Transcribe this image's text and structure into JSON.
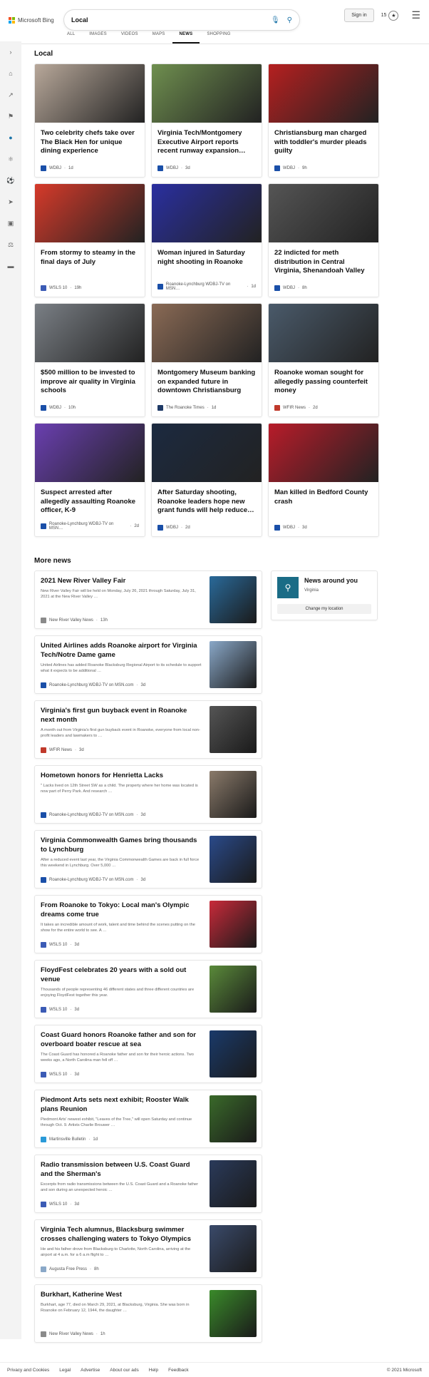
{
  "header": {
    "brand": "Microsoft Bing",
    "query": "Local",
    "signin": "Sign in",
    "points": "15"
  },
  "tabs": [
    "ALL",
    "IMAGES",
    "VIDEOS",
    "MAPS",
    "NEWS",
    "SHOPPING"
  ],
  "active_tab": "NEWS",
  "local": {
    "title": "Local",
    "cards": [
      {
        "title": "Two celebrity chefs take over The Black Hen for unique dining experience",
        "source": "WDBJ",
        "age": "1d",
        "img": "#b8a89a",
        "ic": "#1a4fa8"
      },
      {
        "title": "Virginia Tech/Montgomery Executive Airport reports recent runway expansion…",
        "source": "WDBJ",
        "age": "3d",
        "img": "#6f8f4f",
        "ic": "#1a4fa8"
      },
      {
        "title": "Christiansburg man charged with toddler's murder pleads guilty",
        "source": "WDBJ",
        "age": "9h",
        "img": "#b52020",
        "ic": "#1a4fa8"
      },
      {
        "title": "From stormy to steamy in the final days of July",
        "source": "WSLS 10",
        "age": "19h",
        "img": "#d63a2a",
        "ic": "#3b5bb5"
      },
      {
        "title": "Woman injured in Saturday night shooting in Roanoke",
        "source": "Roanoke-Lynchburg WDBJ-TV on MSN…",
        "age": "1d",
        "img": "#2a2fa0",
        "ic": "#1a4fa8"
      },
      {
        "title": "22 indicted for meth distribution in Central Virginia, Shenandoah Valley",
        "source": "WDBJ",
        "age": "8h",
        "img": "#555555",
        "ic": "#1a4fa8"
      },
      {
        "title": "$500 million to be invested to improve air quality in Virginia schools",
        "source": "WDBJ",
        "age": "10h",
        "img": "#7a7f85",
        "ic": "#1a4fa8"
      },
      {
        "title": "Montgomery Museum banking on expanded future in downtown Christiansburg",
        "source": "The Roanoke Times",
        "age": "1d",
        "img": "#8a6a55",
        "ic": "#1f3a66"
      },
      {
        "title": "Roanoke woman sought for allegedly passing counterfeit money",
        "source": "WFIR News",
        "age": "2d",
        "img": "#4a5a6a",
        "ic": "#c0392b"
      },
      {
        "title": "Suspect arrested after allegedly assaulting Roanoke officer, K-9",
        "source": "Roanoke-Lynchburg WDBJ-TV on MSN…",
        "age": "2d",
        "img": "#6a3fb0",
        "ic": "#1a4fa8"
      },
      {
        "title": "After Saturday shooting, Roanoke leaders hope new grant funds will help reduce…",
        "source": "WDBJ",
        "age": "2d",
        "img": "#1c2a40",
        "ic": "#1a4fa8"
      },
      {
        "title": "Man killed in Bedford County crash",
        "source": "WDBJ",
        "age": "3d",
        "img": "#b81c2a",
        "ic": "#1a4fa8"
      }
    ]
  },
  "more": {
    "title": "More news",
    "items": [
      {
        "title": "2021 New River Valley Fair",
        "snippet": "New River Valley Fair will be held on Monday, July 26, 2021 through Saturday, July 31, 2021 at the New River Valley …",
        "source": "New River Valley News",
        "age": "13h",
        "img": "#2a6a9a",
        "ic": "#8a8a8a"
      },
      {
        "title": "United Airlines adds Roanoke airport for Virginia Tech/Notre Dame game",
        "snippet": "United Airlines has added Roanoke Blacksburg Regional Airport to its schedule to support what it expects to be additional …",
        "source": "Roanoke-Lynchburg WDBJ-TV on MSN.com",
        "age": "3d",
        "img": "#8aa8c8",
        "ic": "#1a4fa8"
      },
      {
        "title": "Virginia's first gun buyback event in Roanoke next month",
        "snippet": "A month out from Virginia's first gun buyback event in Roanoke, everyone from local non-profit leaders and lawmakers to …",
        "source": "WFIR News",
        "age": "3d",
        "img": "#555555",
        "ic": "#c0392b"
      },
      {
        "title": "Hometown honors for Henrietta Lacks",
        "snippet": "\" Lacks lived on 12th Street SW as a child. The property where her home was located is now part of Perry Park. And research …",
        "source": "Roanoke-Lynchburg WDBJ-TV on MSN.com",
        "age": "3d",
        "img": "#8a7a6a",
        "ic": "#1a4fa8"
      },
      {
        "title": "Virginia Commonwealth Games bring thousands to Lynchburg",
        "snippet": "After a reduced event last year, the Virginia Commonwealth Games are back in full force this weekend in Lynchburg. Over 5,000 …",
        "source": "Roanoke-Lynchburg WDBJ-TV on MSN.com",
        "age": "3d",
        "img": "#2a4a8a",
        "ic": "#1a4fa8"
      },
      {
        "title": "From Roanoke to Tokyo: Local man's Olympic dreams come true",
        "snippet": "It takes an incredible amount of work, talent and time behind the scenes putting on the show for the entire world to see. A …",
        "source": "WSLS 10",
        "age": "3d",
        "img": "#c82a3a",
        "ic": "#3b5bb5"
      },
      {
        "title": "FloydFest celebrates 20 years with a sold out venue",
        "snippet": "Thousands of people representing 46 different states and three different countries are enjoying FloydFest together this year.",
        "source": "WSLS 10",
        "age": "3d",
        "img": "#5a8a3a",
        "ic": "#3b5bb5"
      },
      {
        "title": "Coast Guard honors Roanoke father and son for overboard boater rescue at sea",
        "snippet": "The Coast Guard has honored a Roanoke father and son for their heroic actions. Two weeks ago, a North Carolina man fell off …",
        "source": "WSLS 10",
        "age": "3d",
        "img": "#1a3a6a",
        "ic": "#3b5bb5"
      },
      {
        "title": "Piedmont Arts sets next exhibit; Rooster Walk plans Reunion",
        "snippet": "Piedmont Arts' newest exhibit, \"Leaves of the Tree,\" will open Saturday and continue through Oct. 9. Artists Charlie Brouwer …",
        "source": "Martinsville Bulletin",
        "age": "1d",
        "img": "#3a6a2a",
        "ic": "#2a9ad8"
      },
      {
        "title": "Radio transmission between U.S. Coast Guard and the Sherman's",
        "snippet": "Excerpts from radio transmissions between the U.S. Coast Guard and a Roanoke father and son during an unexpected heroic …",
        "source": "WSLS 10",
        "age": "3d",
        "img": "#2a3a5a",
        "ic": "#3b5bb5"
      },
      {
        "title": "Virginia Tech alumnus, Blacksburg swimmer crosses challenging waters to Tokyo Olympics",
        "snippet": "He and his father drove from Blacksburg to Charlotte, North Carolina, arriving at the airport at 4 a.m. for a 6 a.m flight to …",
        "source": "Augusta Free Press",
        "age": "8h",
        "img": "#3a4a6a",
        "ic": "#8aa8c8"
      },
      {
        "title": "Burkhart, Katherine West",
        "snippet": "Burkhart, age 77, died on March 29, 2021, at Blacksburg, Virginia. She was born in Roanoke on February 12, 1944, the daughter …",
        "source": "New River Valley News",
        "age": "1h",
        "img": "#3a8a2a",
        "ic": "#8a8a8a"
      }
    ]
  },
  "around": {
    "title": "News around you",
    "location": "Virginia",
    "button": "Change my location"
  },
  "footer": {
    "links": [
      "Privacy and Cookies",
      "Legal",
      "Advertise",
      "About our ads",
      "Help",
      "Feedback"
    ],
    "copyright": "© 2021 Microsoft"
  }
}
